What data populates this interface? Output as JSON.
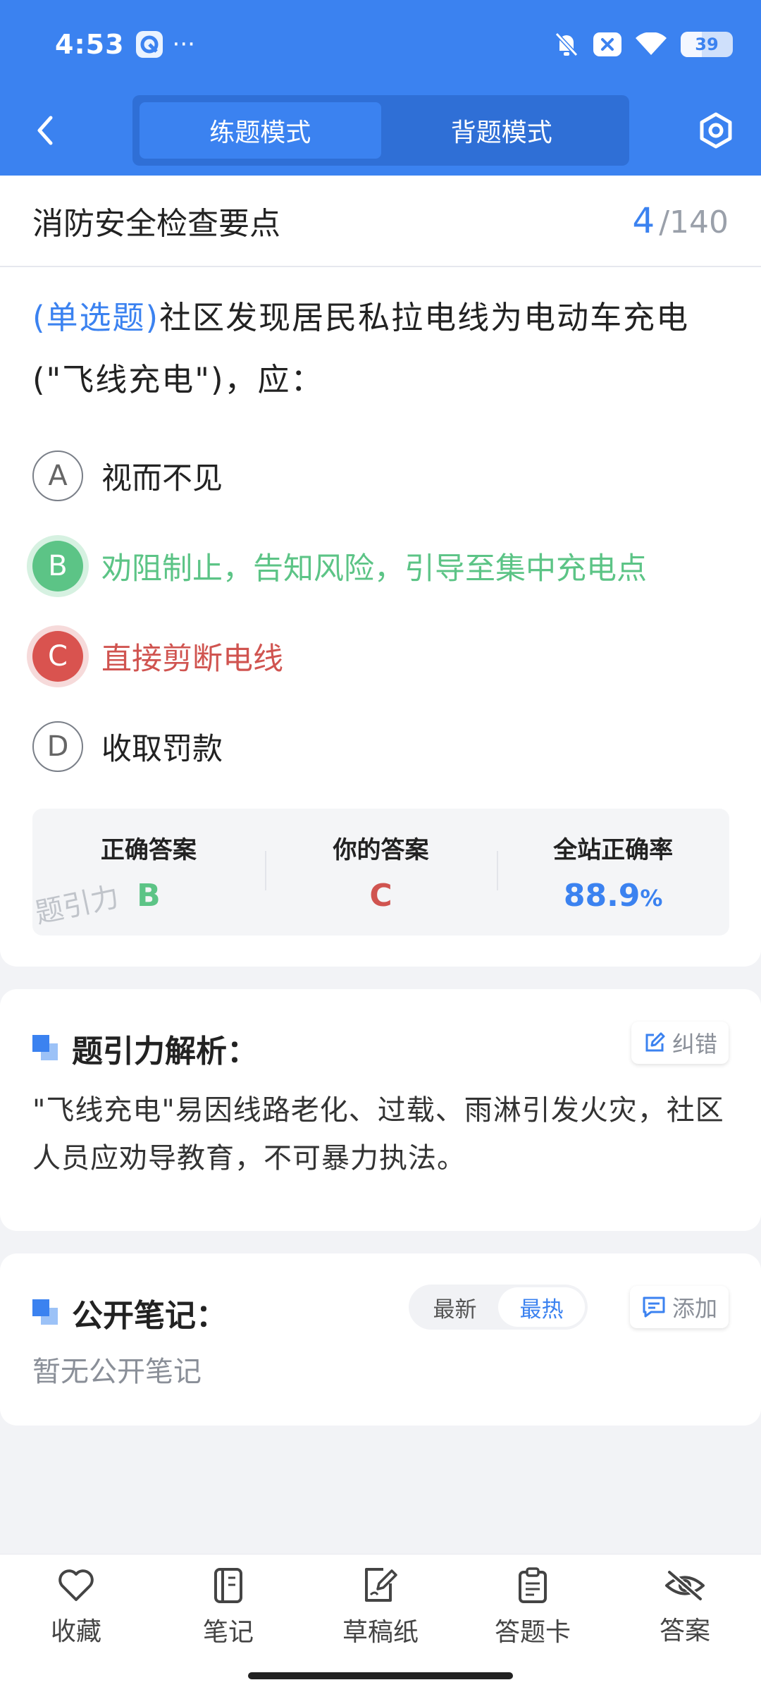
{
  "status_bar": {
    "time": "4:53",
    "more": "···",
    "battery_level": "39",
    "icons": [
      "app-icon",
      "bell-muted-icon",
      "close-box-icon",
      "wifi-icon",
      "battery-icon"
    ]
  },
  "nav": {
    "back_icon": "chevron-left-icon",
    "tabs": [
      {
        "label": "练题模式",
        "active": true
      },
      {
        "label": "背题模式",
        "active": false
      }
    ],
    "settings_icon": "hexagon-settings-icon"
  },
  "question": {
    "category": "消防安全检查要点",
    "current": "4",
    "separator": "/",
    "total": "140",
    "type": "(单选题)",
    "text_line1": "社区发现居民私拉电线为电动车充电",
    "text_line2": "(\"飞线充电\")，应：",
    "options": [
      {
        "letter": "A",
        "text": "视而不见",
        "state": "normal"
      },
      {
        "letter": "B",
        "text": "劝阻制止，告知风险，引导至集中充电点",
        "state": "correct"
      },
      {
        "letter": "C",
        "text": "直接剪断电线",
        "state": "wrong"
      },
      {
        "letter": "D",
        "text": "收取罚款",
        "state": "normal"
      }
    ]
  },
  "answer_summary": {
    "correct_label": "正确答案",
    "correct_value": "B",
    "yours_label": "你的答案",
    "yours_value": "C",
    "rate_label": "全站正确率",
    "rate_value": "88.9",
    "rate_unit": "%",
    "watermark": "题引力"
  },
  "analysis": {
    "title": "题引力解析：",
    "report_label": "纠错",
    "text": "\"飞线充电\"易因线路老化、过载、雨淋引发火灾，社区人员应劝导教育，不可暴力执法。"
  },
  "notes": {
    "title": "公开笔记：",
    "sort_latest": "最新",
    "sort_hottest": "最热",
    "add_label": "添加",
    "empty_text": "暂无公开笔记"
  },
  "bottom_bar": {
    "items": [
      {
        "label": "收藏",
        "icon": "heart-icon"
      },
      {
        "label": "笔记",
        "icon": "notebook-icon"
      },
      {
        "label": "草稿纸",
        "icon": "draft-pen-icon"
      },
      {
        "label": "答题卡",
        "icon": "clipboard-icon"
      },
      {
        "label": "答案",
        "icon": "eye-off-icon"
      }
    ]
  },
  "colors": {
    "primary": "#3b82f0",
    "correct": "#5cc486",
    "wrong": "#d05450"
  }
}
